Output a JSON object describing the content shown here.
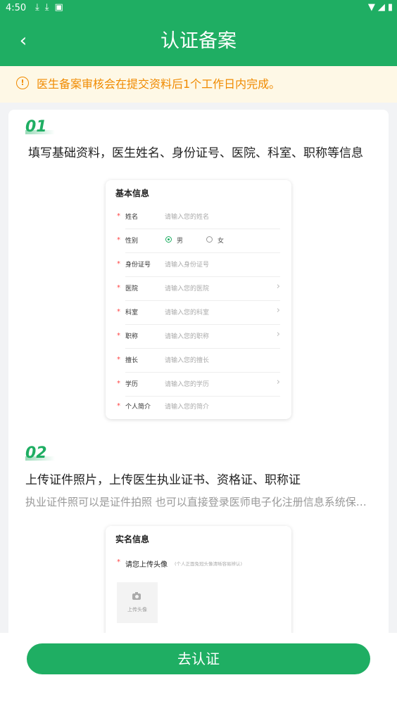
{
  "status_bar": {
    "time": "4:50"
  },
  "header": {
    "title": "认证备案"
  },
  "notice": {
    "text": "医生备案审核会在提交资料后1个工作日内完成。"
  },
  "steps": [
    {
      "number": "01",
      "title": "填写基础资料，医生姓名、身份证号、医院、科室、职称等信息"
    },
    {
      "number": "02",
      "title": "上传证件照片，上传医生执业证书、资格证、职称证",
      "subtitle": "执业证件照可以是证件拍照 也可以直接登录医师电子化注册信息系统保…"
    }
  ],
  "basic_form": {
    "title": "基本信息",
    "fields": [
      {
        "label": "姓名",
        "placeholder": "请输入您的姓名",
        "arrow": false
      },
      {
        "label": "性别",
        "options": [
          "男",
          "女"
        ],
        "selected": "男"
      },
      {
        "label": "身份证号",
        "placeholder": "请输入身份证号",
        "arrow": false
      },
      {
        "label": "医院",
        "placeholder": "请输入您的医院",
        "arrow": true
      },
      {
        "label": "科室",
        "placeholder": "请输入您的科室",
        "arrow": true
      },
      {
        "label": "职称",
        "placeholder": "请输入您的职称",
        "arrow": true
      },
      {
        "label": "擅长",
        "placeholder": "请输入您的擅长",
        "arrow": false
      },
      {
        "label": "学历",
        "placeholder": "请输入您的学历",
        "arrow": true
      },
      {
        "label": "个人简介",
        "placeholder": "请输入您的简介",
        "arrow": false
      }
    ]
  },
  "id_form": {
    "title": "实名信息",
    "upload_label": "请您上传头像",
    "upload_hint": "(个人正面免冠头像清晰容易辨认)",
    "upload_button": "上传头像"
  },
  "cta": {
    "label": "去认证"
  },
  "colors": {
    "brand": "#1fae63",
    "notice_bg": "#fef8e6",
    "notice_text": "#f08a00",
    "required": "#ff4444"
  }
}
